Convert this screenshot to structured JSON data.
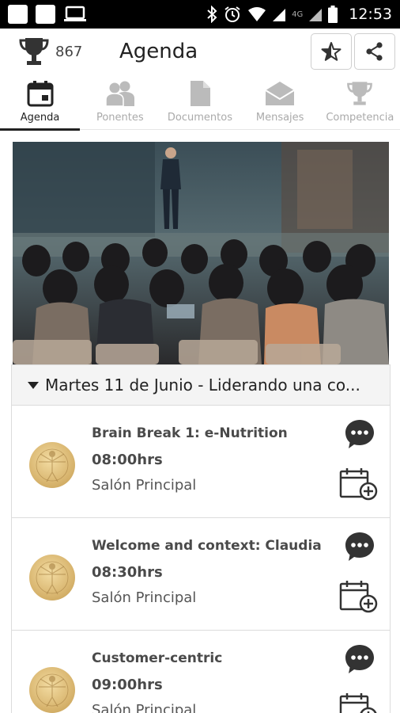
{
  "status_bar": {
    "network_label": "4G",
    "time": "12:53"
  },
  "header": {
    "points": "867",
    "title": "Agenda",
    "icons": [
      "trophy-icon",
      "star-icon",
      "share-icon"
    ]
  },
  "tabs": [
    {
      "label": "Agenda",
      "icon": "calendar-icon",
      "active": true
    },
    {
      "label": "Ponentes",
      "icon": "people-icon",
      "active": false
    },
    {
      "label": "Documentos",
      "icon": "document-icon",
      "active": false
    },
    {
      "label": "Mensajes",
      "icon": "envelope-icon",
      "active": false
    },
    {
      "label": "Competencia",
      "icon": "trophy-icon",
      "active": false
    }
  ],
  "day": {
    "title": "Martes 11 de Junio - Liderando una co..."
  },
  "sessions": [
    {
      "title": "Brain Break 1: e-Nutrition",
      "time": "08:00hrs",
      "room": "Salón Principal"
    },
    {
      "title": "Welcome and context: Claudia",
      "time": "08:30hrs",
      "room": "Salón Principal"
    },
    {
      "title": "Customer-centric",
      "time": "09:00hrs",
      "room": "Salón Principal"
    }
  ],
  "colors": {
    "active_tab": "#222222",
    "inactive_tab": "#aaaaaa",
    "icon_dark": "#333333"
  }
}
